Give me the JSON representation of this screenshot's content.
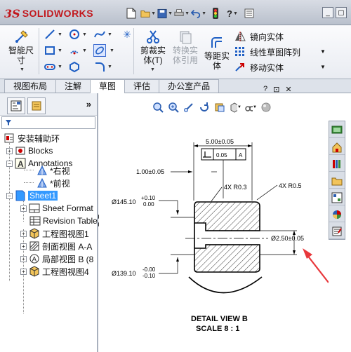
{
  "app": {
    "brand_prefix": "3S",
    "brand": "SOLIDWORKS"
  },
  "quickbar": [
    "new-file",
    "open-folder",
    "save",
    "print",
    "undo",
    "rebuild",
    "help",
    "options"
  ],
  "window_controls": [
    "_",
    "▢"
  ],
  "ribbon": {
    "smart_dimension": "智能尺\n寸",
    "trim": "剪裁实\n体(T)",
    "convert": "转换实\n体引用",
    "offset": "等距实\n体",
    "mirror": "镜向实体",
    "linear_pattern": "线性草图阵列",
    "move": "移动实体"
  },
  "tabs": [
    {
      "label": "视图布局",
      "active": false
    },
    {
      "label": "注解",
      "active": false
    },
    {
      "label": "草图",
      "active": true
    },
    {
      "label": "评估",
      "active": false
    },
    {
      "label": "办公室产品",
      "active": false
    }
  ],
  "panel_controls": [
    "?",
    "⊡",
    "✕"
  ],
  "tree": {
    "more": "»",
    "root": "安装辅助环",
    "items": [
      {
        "label": "Blocks"
      },
      {
        "label": "Annotations"
      },
      {
        "label": "*右视"
      },
      {
        "label": "*前视"
      },
      {
        "label": "Sheet1"
      },
      {
        "label": "Sheet Format"
      },
      {
        "label": "Revision Table"
      },
      {
        "label": "工程图视图1"
      },
      {
        "label": "剖面视图 A-A"
      },
      {
        "label": "局部视图 B (8"
      },
      {
        "label": "工程图视图4"
      }
    ]
  },
  "drawing": {
    "dim_top": "5.00±0.05",
    "fcf_tol": "0.05",
    "fcf_datum": "A",
    "dim_100": "1.00±0.05",
    "cham_left": "4X R0.3",
    "cham_right": "4X R0.5",
    "dim_14510": "Ø145.10",
    "tol_upper1": "+0.10",
    "tol_lower1": "0.00",
    "dim_250": "Ø2.50±0.05",
    "dim_13910": "Ø139.10",
    "tol_upper2": "-0.00",
    "tol_lower2": "-0.10",
    "view_title": "DETAIL VIEW B",
    "view_scale": "SCALE 8 : 1"
  },
  "colors": {
    "accent": "#3399ff",
    "arrow": "#e8373b",
    "brand": "#c2181d"
  }
}
